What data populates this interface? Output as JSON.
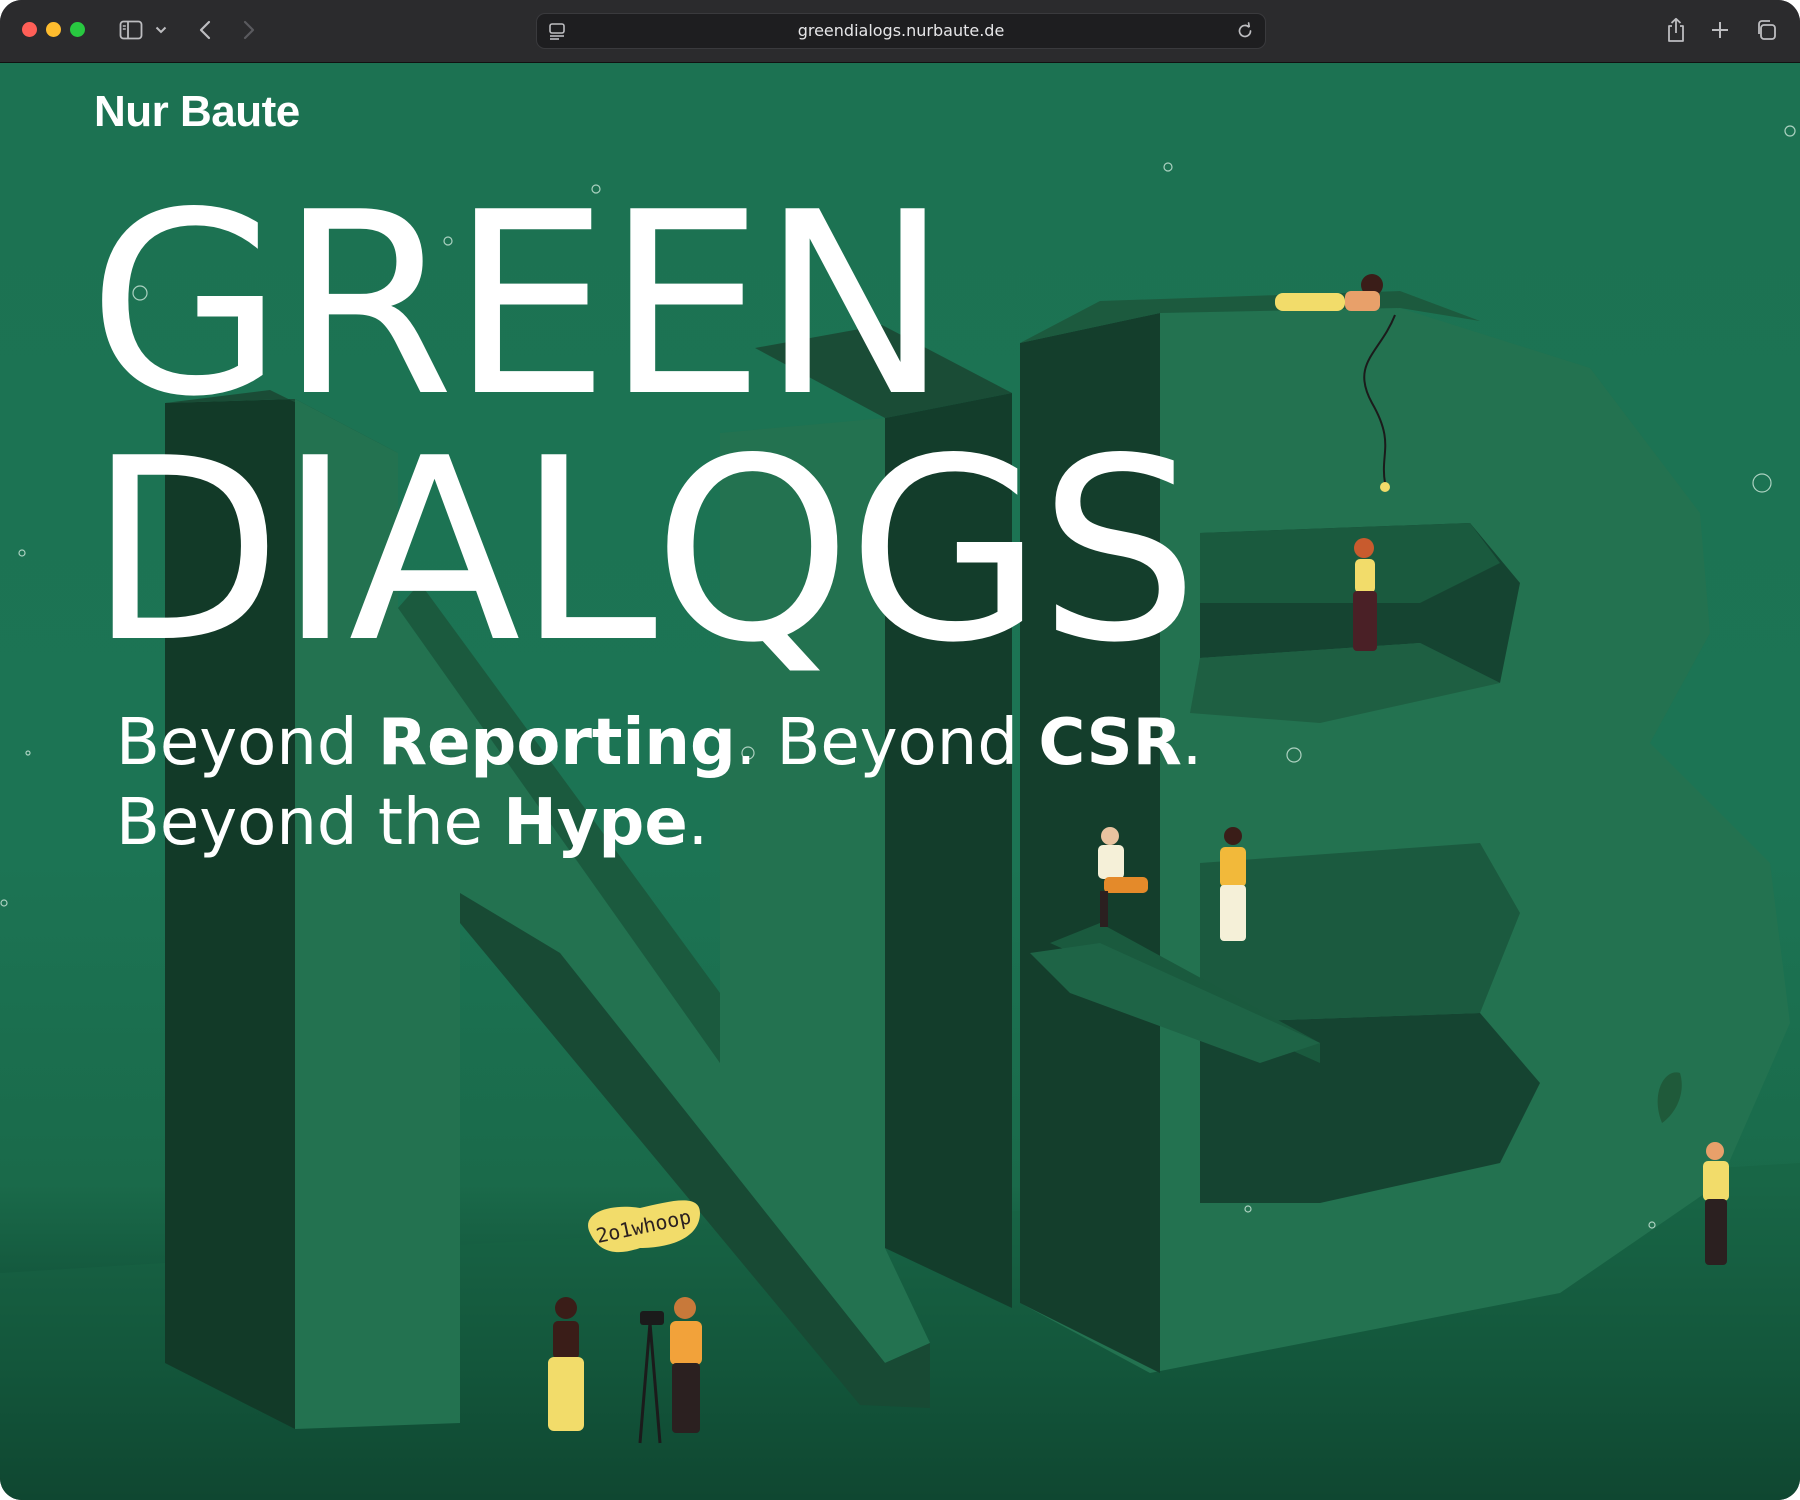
{
  "browser": {
    "url": "greendialogs.nurbaute.de"
  },
  "page": {
    "logo": "Nur Baute",
    "headline_line1": "GREEN",
    "headline_line2": "DIALQGS",
    "tagline": {
      "beyond1": "Beyond ",
      "reporting": "Reporting",
      "dot1": ". ",
      "beyond2": "Beyond ",
      "csr": "CSR",
      "dot2": ".",
      "beyond3": "Beyond the ",
      "hype": "Hype",
      "dot3": "."
    },
    "speech_bubble": "2o1whoop"
  },
  "colors": {
    "background_green": "#1c7252",
    "letter_face": "#226e4c",
    "letter_side": "#1a4a34",
    "accent_yellow": "#f2dc6a"
  },
  "icons": [
    "sidebar-icon",
    "chevron-down-icon",
    "back-icon",
    "forward-icon",
    "reader-icon",
    "reload-icon",
    "share-icon",
    "new-tab-icon",
    "tab-overview-icon"
  ]
}
